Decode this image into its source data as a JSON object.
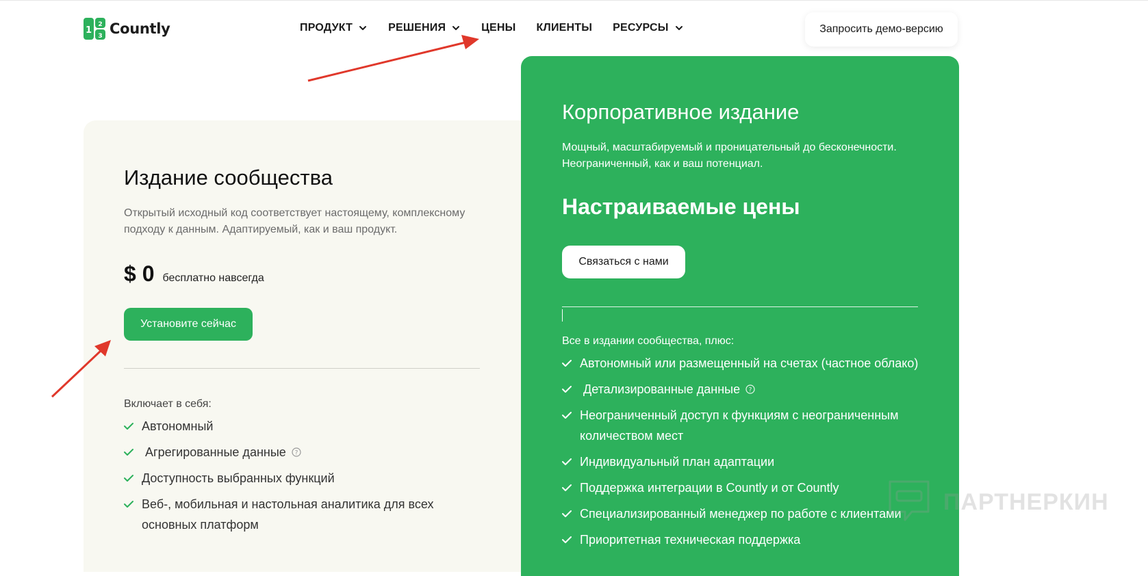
{
  "header": {
    "logo_text": "Countly",
    "nav": [
      {
        "label": "ПРОДУКТ",
        "has_dropdown": true
      },
      {
        "label": "РЕШЕНИЯ",
        "has_dropdown": true
      },
      {
        "label": "ЦЕНЫ",
        "has_dropdown": false
      },
      {
        "label": "КЛИЕНТЫ",
        "has_dropdown": false
      },
      {
        "label": "РЕСУРСЫ",
        "has_dropdown": true
      }
    ],
    "demo_button": "Запросить демо-версию"
  },
  "community": {
    "title": "Издание сообщества",
    "description": "Открытый исходный код соответствует настоящему, комплексному подходу к данным. Адаптируемый, как и ваш продукт.",
    "price": "$ 0",
    "price_note": "бесплатно навсегда",
    "button": "Установите сейчас",
    "includes_label": "Включает в себя:",
    "features": [
      "Автономный",
      " Агрегированные данные",
      "Доступность выбранных функций",
      "Веб-, мобильная и настольная аналитика для всех основных платформ"
    ]
  },
  "enterprise": {
    "title": "Корпоративное издание",
    "description": "Мощный, масштабируемый и проницательный до бесконечности. Неограниченный, как и ваш потенциал.",
    "pricing": "Настраиваемые цены",
    "button": "Связаться с нами",
    "includes_label": "Все в издании сообщества, плюс:",
    "features": [
      "Автономный или размещенный на счетах (частное облако)",
      " Детализированные данные",
      "Неограниченный доступ к функциям с неограниченным количеством мест",
      "Индивидуальный план адаптации",
      "Поддержка интеграции в Countly и от Countly",
      "Специализированный менеджер по работе с клиентами",
      "Приоритетная техническая поддержка"
    ]
  },
  "watermark": {
    "text": "ПАРТНЕРКИН"
  },
  "colors": {
    "brand_green": "#2db15c",
    "community_bg": "#f8f8f1",
    "arrow_red": "#e0382b"
  }
}
